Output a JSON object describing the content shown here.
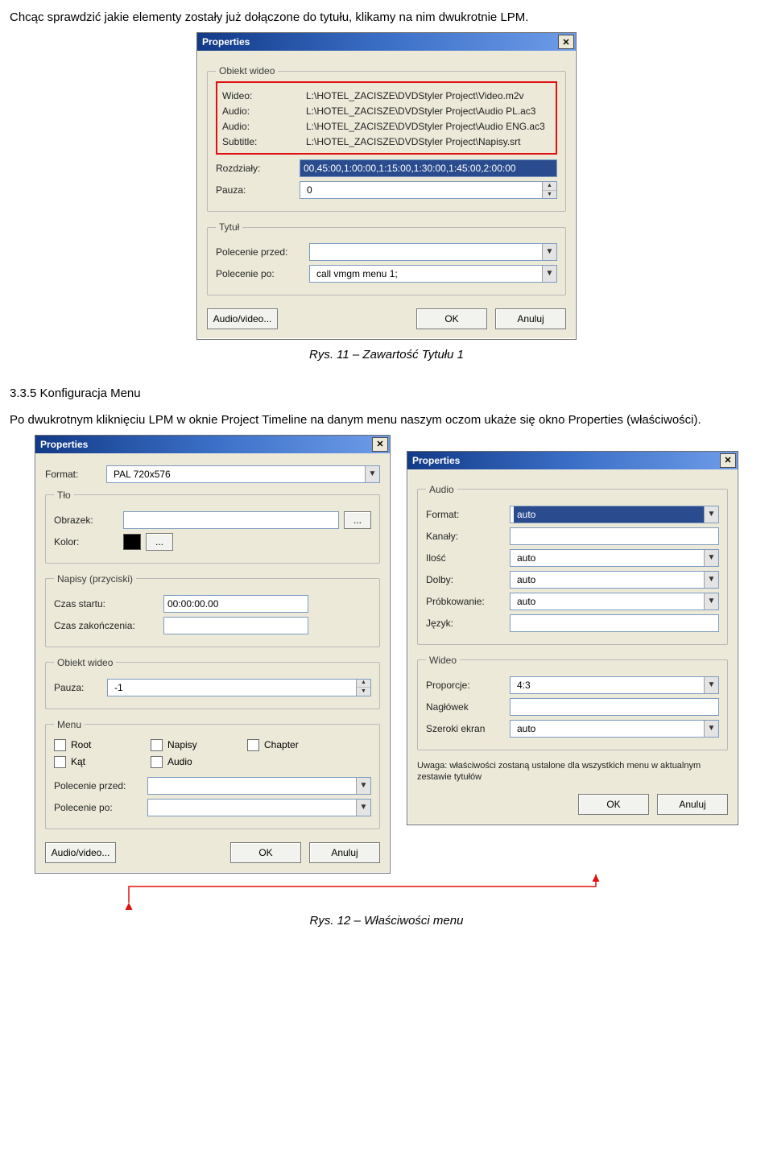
{
  "paragraphs": {
    "p1_a": "Chcąc sprawdzić jakie elementy zostały już dołączone do tytułu, klikamy na nim dwukrotnie LPM.",
    "p2_heading": "3.3.5 Konfiguracja Menu",
    "p2_body": "Po dwukrotnym kliknięciu LPM w oknie Project Timeline na danym menu naszym oczom ukaże się okno Properties (właściwości)."
  },
  "captions": {
    "c1": "Rys. 11 – Zawartość Tytułu 1",
    "c2": "Rys. 12 – Właściwości menu"
  },
  "dlg1": {
    "title": "Properties",
    "grp_video": "Obiekt wideo",
    "rows": {
      "wideo": {
        "label": "Wideo:",
        "value": "L:\\HOTEL_ZACISZE\\DVDStyler Project\\Video.m2v"
      },
      "audio1": {
        "label": "Audio:",
        "value": "L:\\HOTEL_ZACISZE\\DVDStyler Project\\Audio PL.ac3"
      },
      "audio2": {
        "label": "Audio:",
        "value": "L:\\HOTEL_ZACISZE\\DVDStyler Project\\Audio ENG.ac3"
      },
      "sub": {
        "label": "Subtitle:",
        "value": "L:\\HOTEL_ZACISZE\\DVDStyler Project\\Napisy.srt"
      }
    },
    "chapters": {
      "label": "Rozdziały:",
      "value": "00,45:00,1:00:00,1:15:00,1:30:00,1:45:00,2:00:00"
    },
    "pause": {
      "label": "Pauza:",
      "value": "0"
    },
    "grp_title": "Tytuł",
    "cmd_before": {
      "label": "Polecenie przed:",
      "value": ""
    },
    "cmd_after": {
      "label": "Polecenie po:",
      "value": "call vmgm menu 1;"
    },
    "buttons": {
      "av": "Audio/video...",
      "ok": "OK",
      "cancel": "Anuluj"
    }
  },
  "dlgA": {
    "title": "Properties",
    "format": {
      "label": "Format:",
      "value": "PAL 720x576"
    },
    "grp_bg": "Tło",
    "bg_image": {
      "label": "Obrazek:",
      "value": ""
    },
    "bg_color": {
      "label": "Kolor:"
    },
    "browse": "...",
    "grp_sub": "Napisy (przyciski)",
    "start": {
      "label": "Czas startu:",
      "value": "00:00:00.00"
    },
    "end": {
      "label": "Czas zakończenia:",
      "value": ""
    },
    "grp_video": "Obiekt wideo",
    "pause": {
      "label": "Pauza:",
      "value": "-1"
    },
    "grp_menu": "Menu",
    "checks": {
      "root": "Root",
      "chapter": "Chapter",
      "audio": "Audio",
      "napisy": "Napisy",
      "kat": "Kąt"
    },
    "cmd_before": {
      "label": "Polecenie przed:",
      "value": ""
    },
    "cmd_after": {
      "label": "Polecenie po:",
      "value": ""
    },
    "buttons": {
      "av": "Audio/video...",
      "ok": "OK",
      "cancel": "Anuluj"
    }
  },
  "dlgB": {
    "title": "Properties",
    "grp_audio": "Audio",
    "audio": {
      "format": {
        "label": "Format:",
        "value": "auto"
      },
      "channels": {
        "label": "Kanały:",
        "value": ""
      },
      "count": {
        "label": "Ilość",
        "value": "auto"
      },
      "dolby": {
        "label": "Dolby:",
        "value": "auto"
      },
      "sample": {
        "label": "Próbkowanie:",
        "value": "auto"
      },
      "lang": {
        "label": "Język:",
        "value": ""
      }
    },
    "grp_video": "Wideo",
    "video": {
      "aspect": {
        "label": "Proporcje:",
        "value": "4:3"
      },
      "header": {
        "label": "Nagłówek",
        "value": ""
      },
      "wide": {
        "label": "Szeroki ekran",
        "value": "auto"
      }
    },
    "note": "Uwaga: właściwości zostaną ustalone dla wszystkich menu w aktualnym zestawie tytułów",
    "buttons": {
      "ok": "OK",
      "cancel": "Anuluj"
    }
  }
}
